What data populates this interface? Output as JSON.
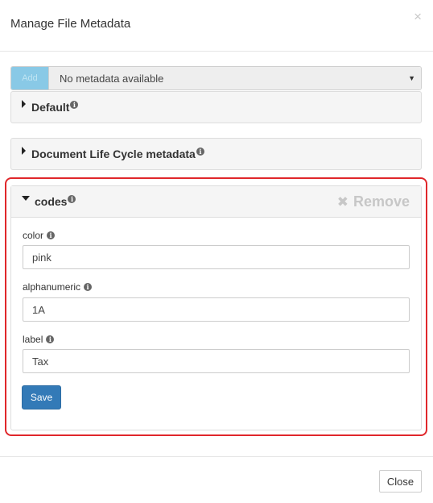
{
  "header": {
    "title": "Manage File Metadata",
    "close_glyph": "×"
  },
  "metadata_select": {
    "add_label": "Add",
    "selected": "No metadata available",
    "caret": "▼"
  },
  "panels": [
    {
      "title": "Default",
      "expanded": false
    },
    {
      "title": "Document Life Cycle metadata",
      "expanded": false
    }
  ],
  "codes_panel": {
    "title": "codes",
    "remove_label": "Remove",
    "remove_icon": "✖",
    "fields": [
      {
        "label": "color",
        "value": "pink"
      },
      {
        "label": "alphanumeric",
        "value": "1A"
      },
      {
        "label": "label",
        "value": "Tax"
      }
    ],
    "save_label": "Save"
  },
  "footer": {
    "close_label": "Close"
  },
  "info_glyph": "i",
  "colors": {
    "primary": "#337ab7",
    "highlight": "#e0272b",
    "add_button": "#89c9e6"
  }
}
